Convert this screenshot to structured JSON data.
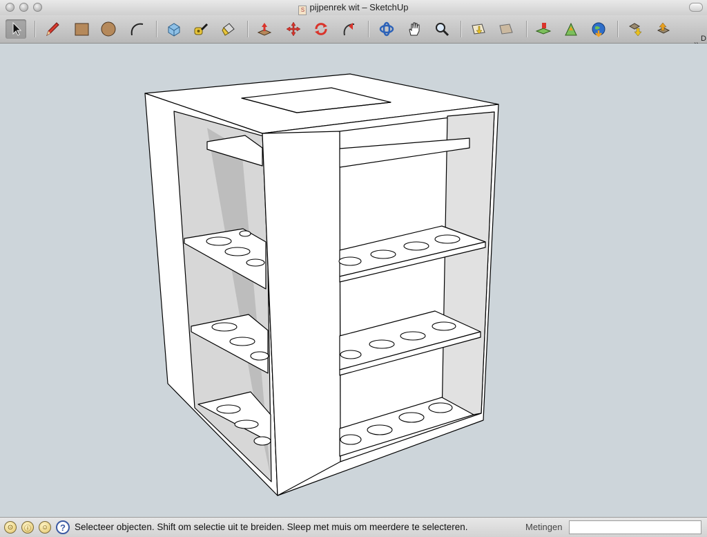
{
  "window": {
    "title": "pijpenrek wit – SketchUp"
  },
  "toolbar": {
    "tools": [
      {
        "name": "select-tool",
        "icon": "arrow-cursor-icon"
      },
      {
        "name": "pencil-tool",
        "icon": "pencil-icon"
      },
      {
        "name": "rectangle-tool",
        "icon": "rectangle-icon"
      },
      {
        "name": "circle-tool",
        "icon": "circle-icon"
      },
      {
        "name": "arc-tool",
        "icon": "arc-icon"
      },
      {
        "name": "make-component-tool",
        "icon": "component-icon"
      },
      {
        "name": "tape-measure-tool",
        "icon": "tape-measure-icon"
      },
      {
        "name": "paint-bucket-tool",
        "icon": "paint-bucket-icon"
      },
      {
        "name": "push-pull-tool",
        "icon": "push-pull-icon"
      },
      {
        "name": "move-tool",
        "icon": "move-icon"
      },
      {
        "name": "rotate-tool",
        "icon": "rotate-icon"
      },
      {
        "name": "follow-me-tool",
        "icon": "follow-me-icon"
      },
      {
        "name": "orbit-tool",
        "icon": "orbit-icon"
      },
      {
        "name": "pan-tool",
        "icon": "hand-icon"
      },
      {
        "name": "zoom-tool",
        "icon": "magnifier-icon"
      },
      {
        "name": "previous-view-tool",
        "icon": "previous-view-icon"
      },
      {
        "name": "next-view-tool",
        "icon": "next-view-icon"
      },
      {
        "name": "add-location-tool",
        "icon": "location-icon"
      },
      {
        "name": "toggle-terrain-tool",
        "icon": "terrain-icon"
      },
      {
        "name": "google-earth-tool",
        "icon": "globe-icon"
      },
      {
        "name": "get-models-tool",
        "icon": "get-models-icon"
      },
      {
        "name": "share-model-tool",
        "icon": "share-model-icon"
      }
    ],
    "overflow_label": "»",
    "overflow_letter": "D"
  },
  "viewport": {
    "background": "#cdd5da",
    "model_face": "#ffffff",
    "model_shade": "#d6d6d6"
  },
  "statusbar": {
    "help_label": "?",
    "message": "Selecteer objecten. Shift om selectie uit te breiden. Sleep met muis om meerdere te selecteren.",
    "measurements_label": "Metingen",
    "measurements_value": ""
  }
}
